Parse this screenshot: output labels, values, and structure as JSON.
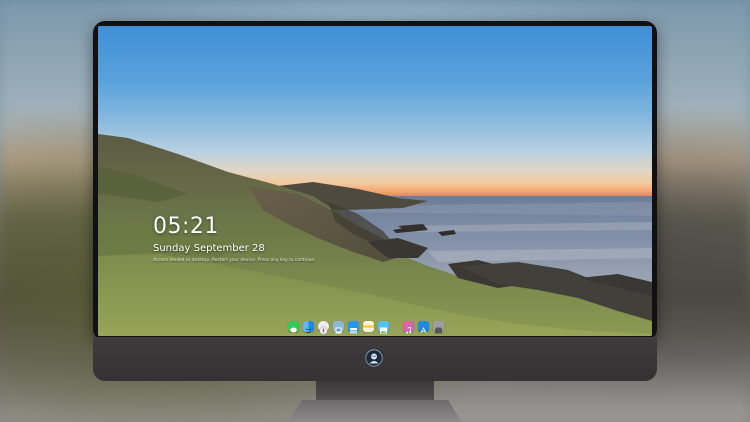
{
  "lock_screen": {
    "time": "05:21",
    "date": "Sunday September  28",
    "notice": "Access denied to desktop. Restart your device. Press any key to continue."
  },
  "dock": {
    "icons": [
      {
        "name": "messages-icon",
        "color": "#34c759"
      },
      {
        "name": "finder-icon",
        "color": "#1e88e5"
      },
      {
        "name": "safari-icon",
        "color": "#e8e8e8"
      },
      {
        "name": "preview-icon",
        "color": "#8fb8d8"
      },
      {
        "name": "claquette-icon",
        "color": "#2196f3"
      },
      {
        "name": "notes-icon",
        "color": "#ffd54f"
      },
      {
        "name": "photos-icon",
        "color": "#4fc3f7"
      },
      {
        "name": "music-icon",
        "color": "#e040fb"
      },
      {
        "name": "app-store-icon",
        "color": "#1e88e5"
      },
      {
        "name": "tray-icon",
        "color": "#9e9e9e"
      }
    ]
  },
  "colors": {
    "bezel": "#111114",
    "chin": "#3d3b3c",
    "stand": "#8d8a8b"
  }
}
